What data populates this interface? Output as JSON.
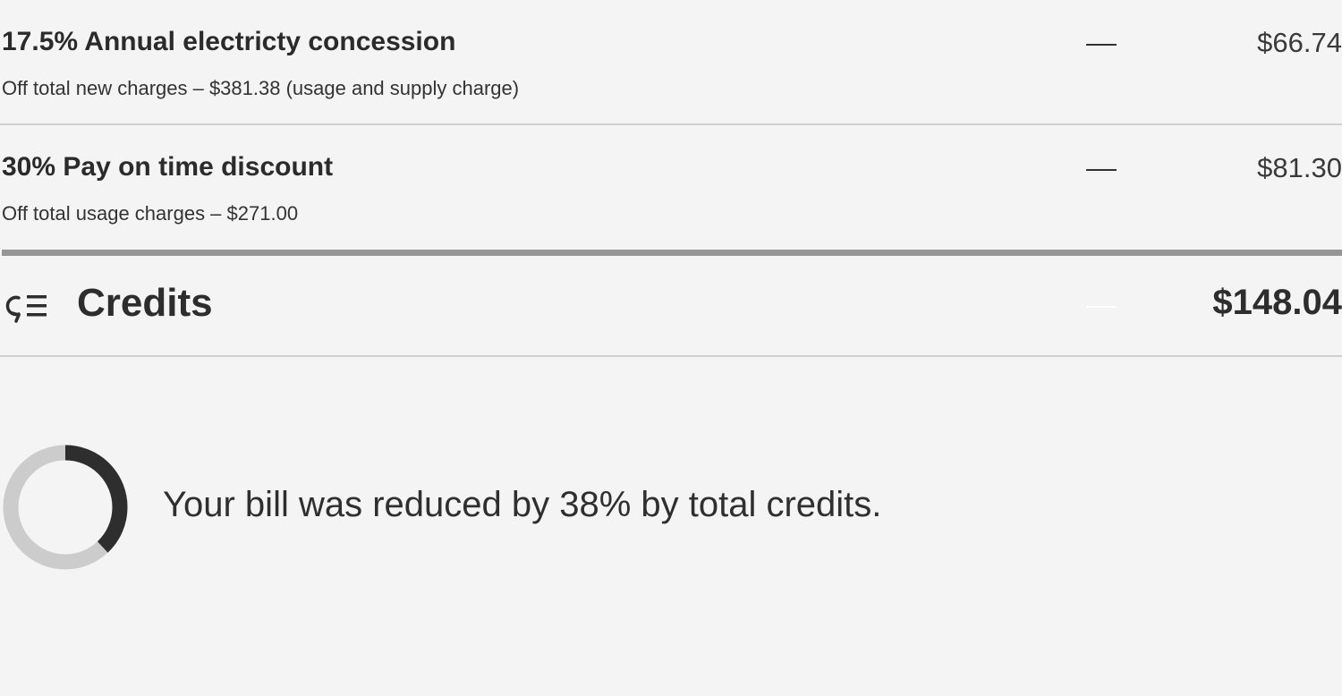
{
  "credits": {
    "items": [
      {
        "title": "17.5% Annual electricty concession",
        "description": "Off total new charges – $381.38 (usage and supply charge)",
        "dash": "—",
        "amount": "$66.74"
      },
      {
        "title": "30% Pay on time discount",
        "description": "Off total usage charges – $271.00",
        "dash": "—",
        "amount": "$81.30"
      }
    ],
    "total": {
      "icon": "credits-list-icon",
      "label": "Credits",
      "amount": "$148.04"
    }
  },
  "summary": {
    "text": "Your bill was reduced by 38% by total credits.",
    "reduction_percent": 38,
    "donut_colors": {
      "filled": "#2e2e2e",
      "track": "#cccccc"
    }
  }
}
